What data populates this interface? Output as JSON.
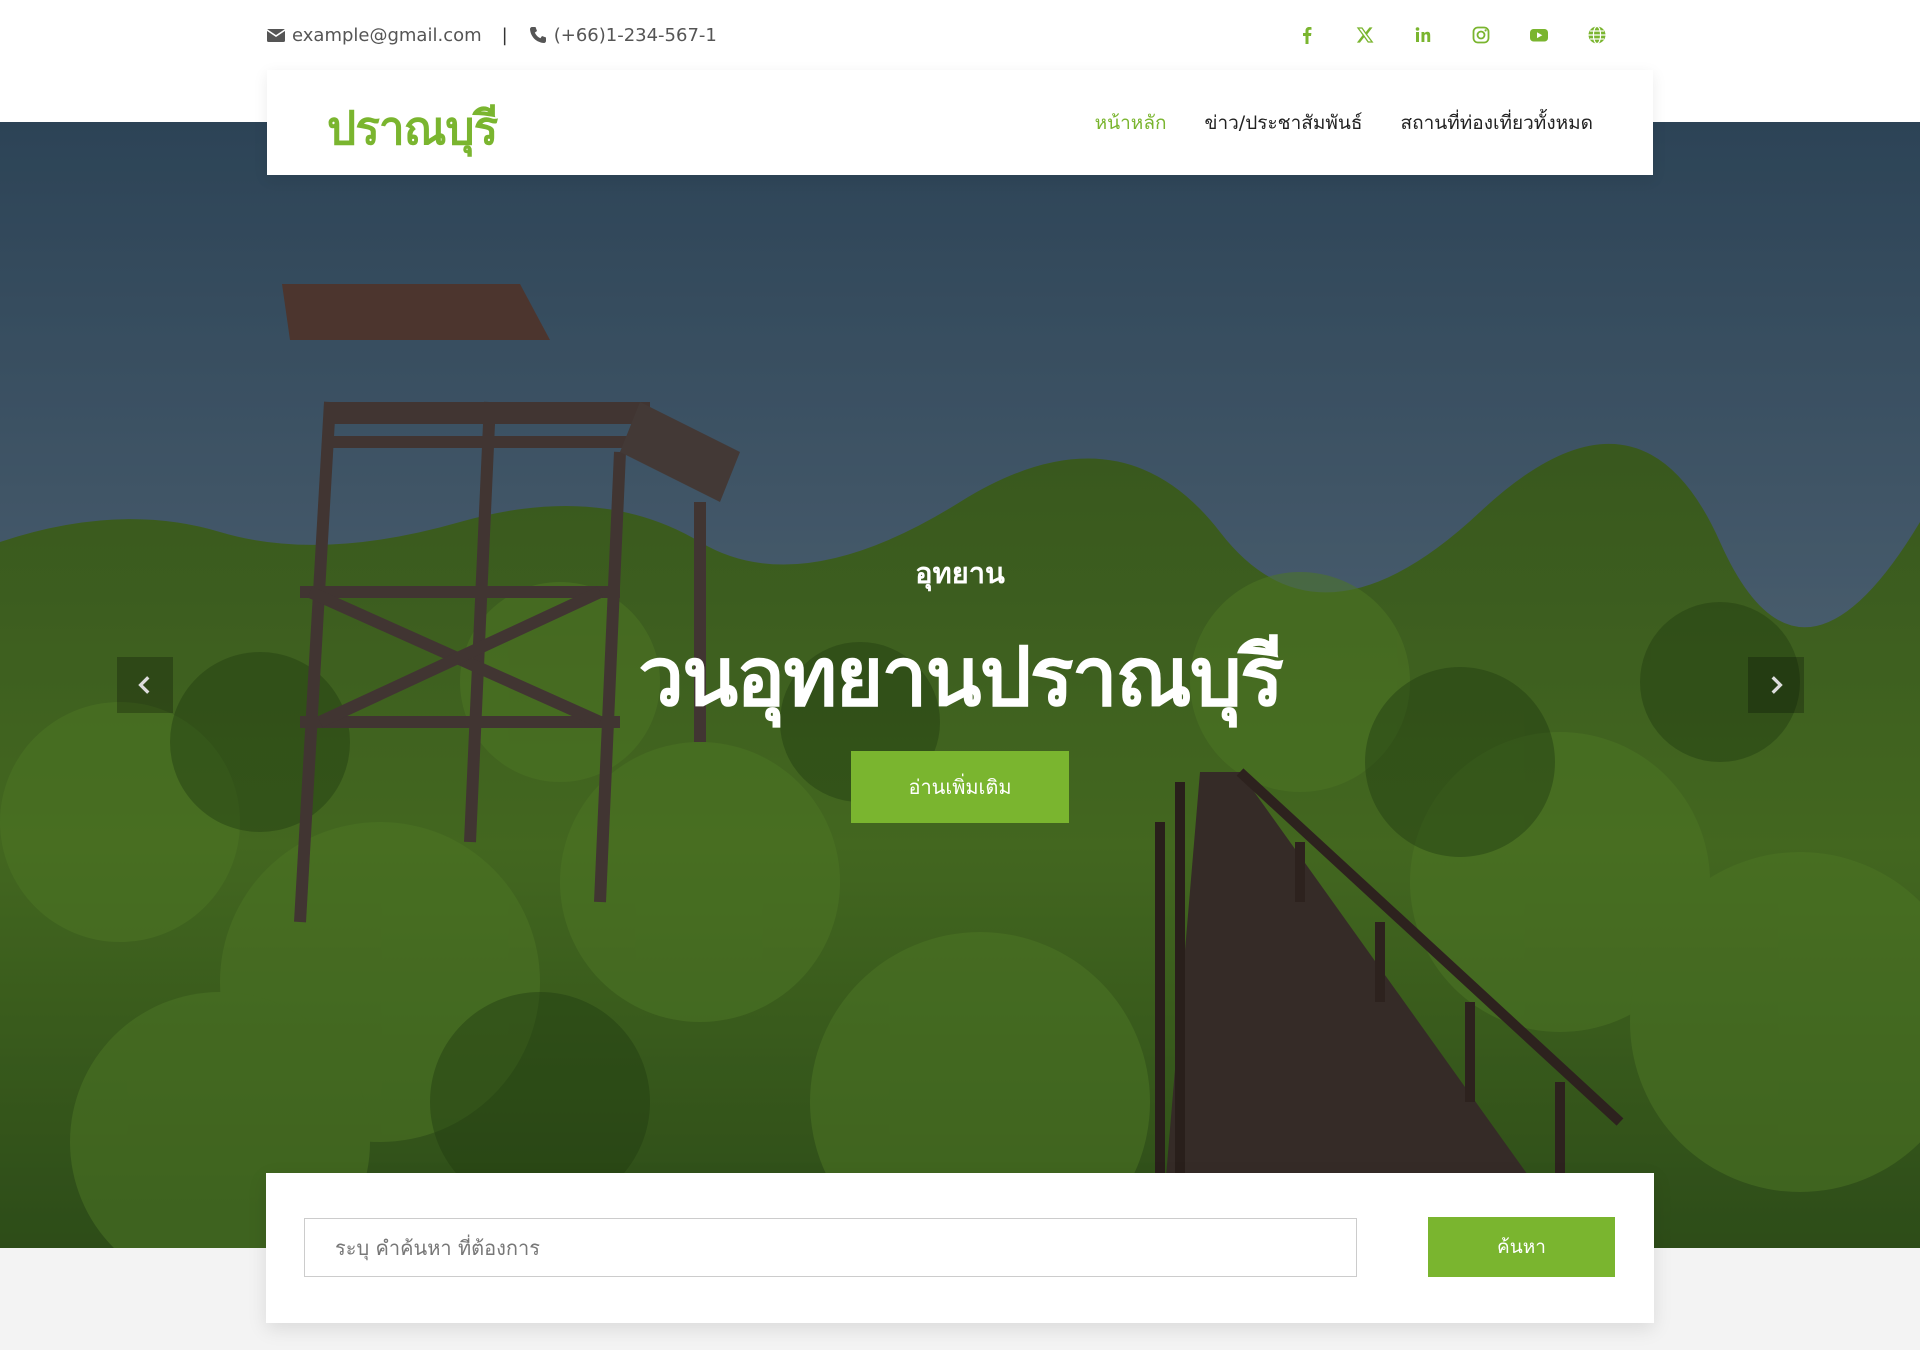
{
  "colors": {
    "accent": "#7ab52f"
  },
  "topbar": {
    "email": "example@gmail.com",
    "separator": "|",
    "phone": "(+66)1-234-567-1",
    "social_icons": [
      "facebook-icon",
      "x-twitter-icon",
      "linkedin-icon",
      "instagram-icon",
      "youtube-icon",
      "globe-icon"
    ]
  },
  "nav": {
    "logo": "ปราณบุรี",
    "items": [
      {
        "label": "หน้าหลัก",
        "active": true
      },
      {
        "label": "ข่าว/ประชาสัมพันธ์",
        "active": false
      },
      {
        "label": "สถานที่ท่องเที่ยวทั้งหมด",
        "active": false
      }
    ]
  },
  "hero": {
    "subtitle": "อุทยาน",
    "title": "วนอุทยานปราณบุรี",
    "button_label": "อ่านเพิ่มเติม",
    "prev_icon": "chevron-left-icon",
    "next_icon": "chevron-right-icon"
  },
  "search": {
    "placeholder": "ระบุ คำค้นหา ที่ต้องการ",
    "button_label": "ค้นหา"
  }
}
